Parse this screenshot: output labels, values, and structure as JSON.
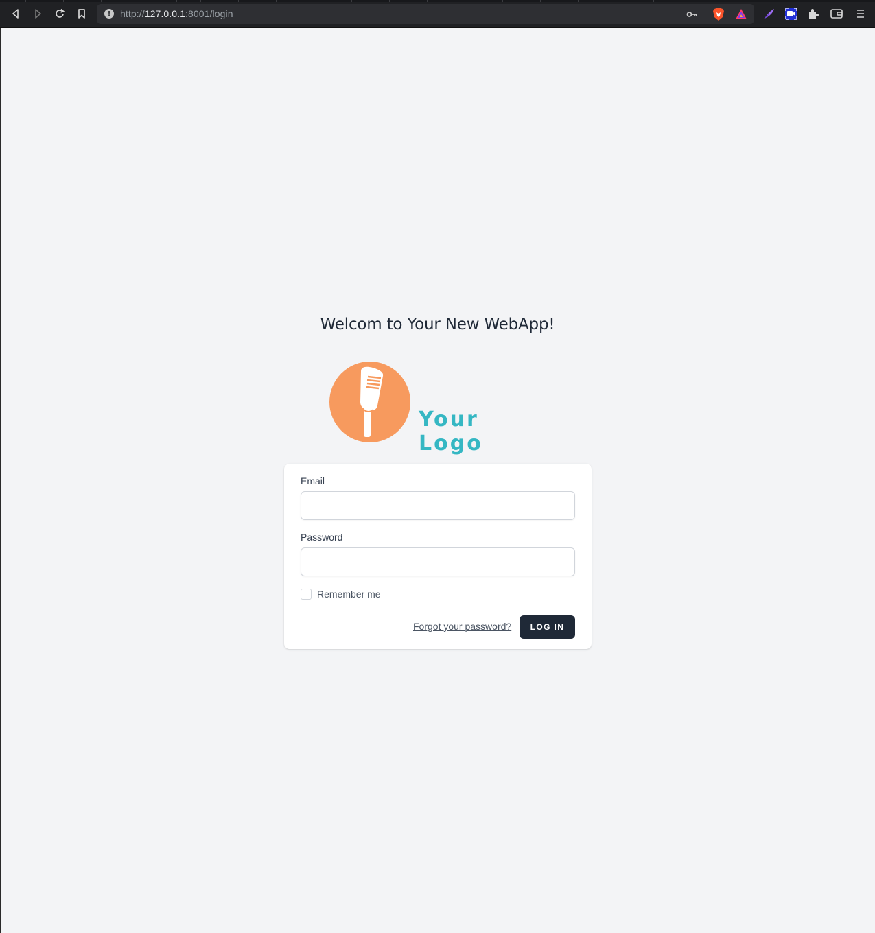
{
  "browser": {
    "url_scheme": "http://",
    "url_host": "127.0.0.1",
    "url_rest": ":8001/login",
    "icons": [
      "back-icon",
      "forward-icon",
      "reload-icon",
      "bookmark-icon",
      "site-info-icon",
      "key-icon",
      "brave-shields-icon",
      "brave-rewards-icon",
      "feather-extension-icon",
      "screen-recorder-extension-icon",
      "extensions-icon",
      "wallet-icon",
      "menu-icon"
    ]
  },
  "page": {
    "welcome_title": "Welcom to Your New WebApp!",
    "logo_text": "Your Logo"
  },
  "login_form": {
    "email_label": "Email",
    "email_value": "",
    "password_label": "Password",
    "password_value": "",
    "remember_label": "Remember me",
    "remember_checked": false,
    "forgot_link": "Forgot your password?",
    "submit_label": "LOG IN"
  },
  "colors": {
    "page_bg": "#f3f4f6",
    "logo_circle": "#f79a5e",
    "logo_text": "#35b7c3",
    "button_bg": "#1f2937"
  }
}
